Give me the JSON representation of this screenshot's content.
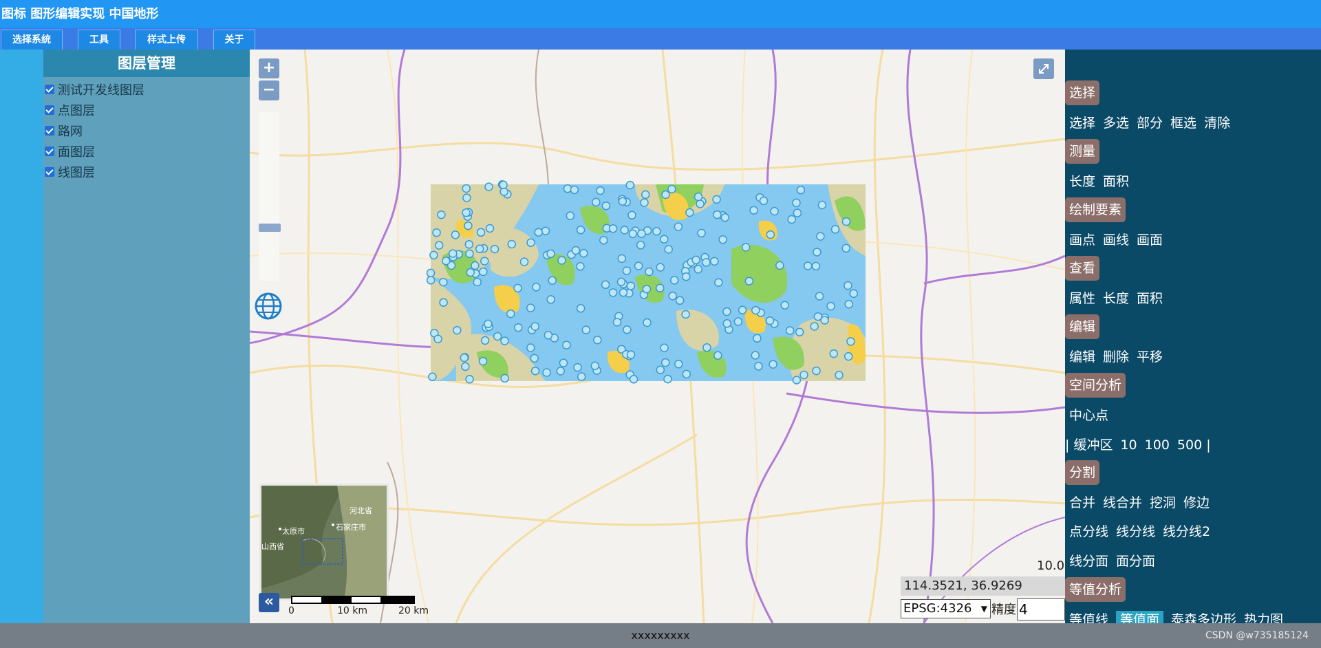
{
  "title": "图标 图形编辑实现 中国地形",
  "menu": [
    "选择系统",
    "工具",
    "样式上传",
    "关于"
  ],
  "layer_panel": {
    "title": "图层管理",
    "layers": [
      {
        "label": "测试开发线图层",
        "checked": true
      },
      {
        "label": "点图层",
        "checked": true
      },
      {
        "label": "路网",
        "checked": true
      },
      {
        "label": "面图层",
        "checked": true
      },
      {
        "label": "线图层",
        "checked": true
      }
    ]
  },
  "map": {
    "zoom_in": "+",
    "zoom_out": "−",
    "zoom_level": "10.0",
    "coordinates": "114.3521, 36.9269",
    "crs": "EPSG:4326",
    "precision_label": "精度",
    "precision_value": "4",
    "overview_toggle": "«",
    "scale": {
      "zero": "0",
      "mid": "10 km",
      "end": "20 km"
    },
    "overview_labels": [
      "河北省",
      "太原市",
      "石家庄市",
      "山西省"
    ],
    "colors": {
      "blue": "#85c8f0",
      "green": "#8fd05e",
      "yellow": "#f5cf4a",
      "tan": "#d9d3a8"
    }
  },
  "tools": {
    "sections": [
      {
        "title": "选择",
        "rows": [
          [
            "选择",
            "多选",
            "部分",
            "框选",
            "清除"
          ]
        ]
      },
      {
        "title": "测量",
        "rows": [
          [
            "长度",
            "面积"
          ]
        ]
      },
      {
        "title": "绘制要素",
        "rows": [
          [
            "画点",
            "画线",
            "画面"
          ]
        ]
      },
      {
        "title": "查看",
        "rows": [
          [
            "属性",
            "长度",
            "面积"
          ]
        ]
      },
      {
        "title": "编辑",
        "rows": [
          [
            "编辑",
            "删除",
            "平移"
          ]
        ]
      },
      {
        "title": "空间分析",
        "rows": [
          [
            "中心点"
          ],
          [
            "| 缓冲区",
            "10",
            "100",
            "500 |"
          ]
        ]
      },
      {
        "title": "分割",
        "rows": [
          [
            "合并",
            "线合并",
            "挖洞",
            "修边"
          ],
          [
            "点分线",
            "线分线",
            "线分线2"
          ],
          [
            "线分面",
            "面分面"
          ]
        ]
      },
      {
        "title": "等值分析",
        "rows": [
          [
            "等值线",
            "等值面",
            "泰森多边形",
            "热力图"
          ]
        ]
      }
    ],
    "active_item": "等值面"
  },
  "footer": {
    "text": "xxxxxxxxx",
    "watermark": "CSDN @w735185124"
  }
}
